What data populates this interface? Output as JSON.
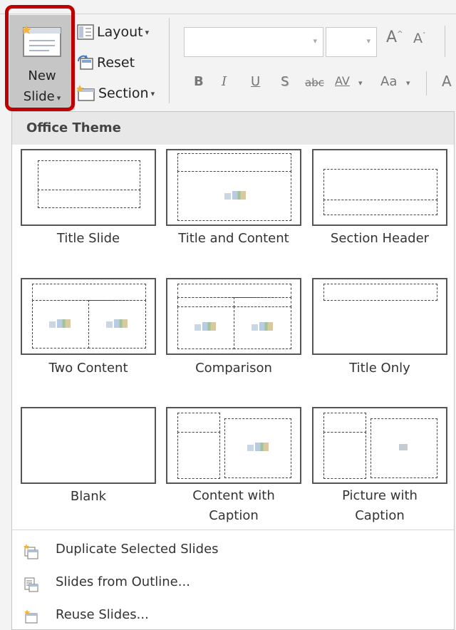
{
  "ribbon": {
    "new_slide": {
      "label_line1": "New",
      "label_line2": "Slide",
      "caret": "▾"
    },
    "layout_label": "Layout",
    "reset_label": "Reset",
    "section_label": "Section",
    "dropdown_caret": "▾",
    "font_name_value": "",
    "font_size_value": "",
    "grow_font_label": "A",
    "shrink_font_label": "A",
    "bold_label": "B",
    "italic_label": "I",
    "underline_label": "U",
    "shadow_label": "S",
    "strikethrough_label": "abc",
    "char_spacing_label": "AV",
    "change_case_label": "Aa",
    "font_color_label": "A",
    "accent_color": "#c00000"
  },
  "gallery": {
    "section_title": "Office Theme",
    "layouts": [
      {
        "label": "Title Slide"
      },
      {
        "label": "Title and Content"
      },
      {
        "label": "Section Header"
      },
      {
        "label": "Two Content"
      },
      {
        "label": "Comparison"
      },
      {
        "label": "Title Only"
      },
      {
        "label": "Blank"
      },
      {
        "label_line1": "Content with",
        "label_line2": "Caption"
      },
      {
        "label_line1": "Picture with",
        "label_line2": "Caption"
      }
    ]
  },
  "menu": [
    {
      "label": "Duplicate Selected Slides",
      "icon": "duplicate-slides-icon"
    },
    {
      "label": "Slides from Outline...",
      "icon": "slides-from-outline-icon"
    },
    {
      "label": "Reuse Slides...",
      "icon": "reuse-slides-icon"
    }
  ]
}
